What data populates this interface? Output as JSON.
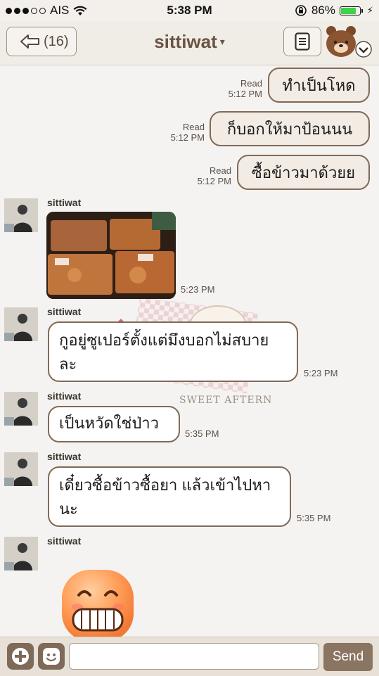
{
  "status_bar": {
    "carrier": "AIS",
    "time": "5:38 PM",
    "battery_percent": "86%",
    "battery_level": 0.86,
    "signal_bars": 3
  },
  "header": {
    "back_count": "(16)",
    "title": "sittiwat",
    "caret": "▾"
  },
  "messages_out": [
    {
      "text": "ทำเป็นโหด",
      "status": "Read",
      "time": "5:12 PM"
    },
    {
      "text": "ก็บอกให้มาป้อนนน",
      "status": "Read",
      "time": "5:12 PM"
    },
    {
      "text": "ซื้อข้าวมาด้วยย",
      "status": "Read",
      "time": "5:12 PM"
    }
  ],
  "messages_in": [
    {
      "sender": "sittiwat",
      "type": "image",
      "time": "5:23 PM"
    },
    {
      "sender": "sittiwat",
      "line1": "กูอยู่ซูเปอร์ตั้งแต่มึงบอกไม่สบาย",
      "line2": "ละ",
      "time": "5:23 PM"
    },
    {
      "sender": "sittiwat",
      "line1": "เป็นหวัดใช่ป่าว",
      "line2": "",
      "time": "5:35 PM"
    },
    {
      "sender": "sittiwat",
      "line1": "เดี๋ยวซื้อข้าวซื้อยา แล้วเข้าไปหา",
      "line2": "นะ",
      "time": "5:35 PM"
    },
    {
      "sender": "sittiwat",
      "type": "sticker"
    }
  ],
  "background_text": "SWEET AFTERNOON",
  "input_bar": {
    "placeholder": "",
    "send_label": "Send"
  },
  "colors": {
    "bubble_border": "#7f6a58",
    "outgoing_bubble": "#f2ece4",
    "incoming_bubble": "#ffffff",
    "header_text": "#6b5444",
    "send_button": "#8a7462",
    "battery": "#3fd24b"
  }
}
